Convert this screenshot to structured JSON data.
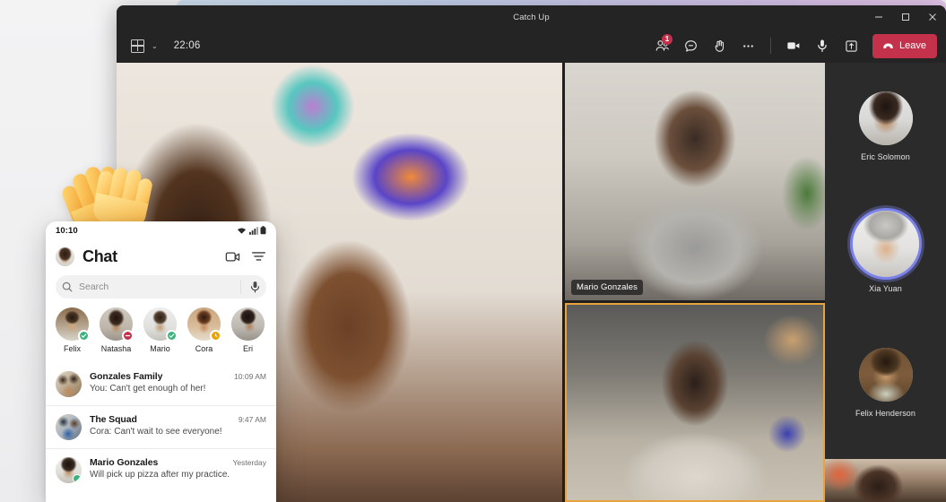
{
  "window": {
    "title": "Catch Up",
    "controls": [
      {
        "name": "minimize",
        "glyph": "─"
      },
      {
        "name": "maximize",
        "glyph": "❐"
      },
      {
        "name": "close",
        "glyph": "✕"
      }
    ]
  },
  "toolbar": {
    "layout_icon": "grid-icon",
    "layout_chevron": "⌄",
    "clock": "22:06",
    "actions": [
      {
        "name": "people-button",
        "icon": "people-icon",
        "badge": "1"
      },
      {
        "name": "chat-button",
        "icon": "chat-bubble-icon",
        "badge": ""
      },
      {
        "name": "react-button",
        "icon": "raise-hand-icon",
        "badge": ""
      },
      {
        "name": "more-button",
        "icon": "ellipsis-icon",
        "badge": ""
      },
      {
        "name": "camera-button",
        "icon": "video-camera-icon",
        "badge": ""
      },
      {
        "name": "mic-button",
        "icon": "microphone-icon",
        "badge": ""
      },
      {
        "name": "share-button",
        "icon": "share-screen-icon",
        "badge": ""
      }
    ],
    "leave_label": "Leave",
    "leave_color": "#C4314B"
  },
  "stage": {
    "tiles": [
      {
        "name": "tile-main",
        "label": "",
        "speaking": false
      },
      {
        "name": "tile-mario-gonzales",
        "label": "Mario Gonzales",
        "speaking": false
      },
      {
        "name": "tile-active-speaker",
        "label": "",
        "speaking": true
      }
    ],
    "active_border_color": "#E8A33D"
  },
  "roster": {
    "participants": [
      {
        "name": "Eric Solomon",
        "speaking": false
      },
      {
        "name": "Xia Yuan",
        "speaking": true
      },
      {
        "name": "Felix Henderson",
        "speaking": false
      }
    ],
    "speaking_ring_color": "#7B83EB"
  },
  "phone": {
    "status_bar": {
      "time": "10:10",
      "icons": [
        "wifi-icon",
        "cellular-signal-icon",
        "battery-icon"
      ]
    },
    "header": {
      "title": "Chat",
      "avatar": "user-avatar",
      "actions": [
        {
          "name": "new-video-call-button",
          "icon": "video-camera-icon"
        },
        {
          "name": "filter-button",
          "icon": "filter-icon"
        }
      ]
    },
    "search": {
      "placeholder": "Search",
      "icon": "search-icon",
      "mic_icon": "microphone-icon"
    },
    "people": [
      {
        "name": "Felix",
        "presence": "available",
        "presence_color": "#3DB27E"
      },
      {
        "name": "Natasha",
        "presence": "busy",
        "presence_color": "#C4314B"
      },
      {
        "name": "Mario",
        "presence": "available",
        "presence_color": "#3DB27E"
      },
      {
        "name": "Cora",
        "presence": "away",
        "presence_color": "#EAA300"
      },
      {
        "name": "Eri",
        "presence": "none",
        "presence_color": "transparent"
      }
    ],
    "chats": [
      {
        "title": "Gonzales Family",
        "preview": "You: Can't get enough of her!",
        "time": "10:09 AM",
        "presence": "none",
        "presence_color": "transparent"
      },
      {
        "title": "The Squad",
        "preview": "Cora: Can't wait to see everyone!",
        "time": "9:47 AM",
        "presence": "none",
        "presence_color": "transparent"
      },
      {
        "title": "Mario Gonzales",
        "preview": "Will pick up pizza after my practice.",
        "time": "Yesterday",
        "presence": "available",
        "presence_color": "#3DB27E"
      }
    ]
  },
  "reaction": {
    "name": "clapping-hands-emoji",
    "color": "#F7C24A"
  }
}
